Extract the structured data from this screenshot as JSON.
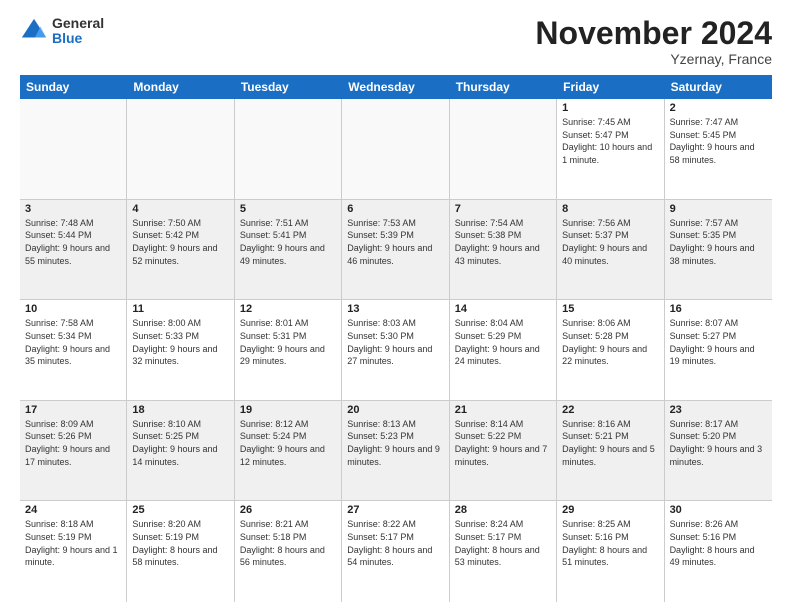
{
  "logo": {
    "general": "General",
    "blue": "Blue"
  },
  "title": "November 2024",
  "location": "Yzernay, France",
  "days": [
    "Sunday",
    "Monday",
    "Tuesday",
    "Wednesday",
    "Thursday",
    "Friday",
    "Saturday"
  ],
  "weeks": [
    [
      {
        "day": "",
        "info": ""
      },
      {
        "day": "",
        "info": ""
      },
      {
        "day": "",
        "info": ""
      },
      {
        "day": "",
        "info": ""
      },
      {
        "day": "",
        "info": ""
      },
      {
        "day": "1",
        "info": "Sunrise: 7:45 AM\nSunset: 5:47 PM\nDaylight: 10 hours and 1 minute."
      },
      {
        "day": "2",
        "info": "Sunrise: 7:47 AM\nSunset: 5:45 PM\nDaylight: 9 hours and 58 minutes."
      }
    ],
    [
      {
        "day": "3",
        "info": "Sunrise: 7:48 AM\nSunset: 5:44 PM\nDaylight: 9 hours and 55 minutes."
      },
      {
        "day": "4",
        "info": "Sunrise: 7:50 AM\nSunset: 5:42 PM\nDaylight: 9 hours and 52 minutes."
      },
      {
        "day": "5",
        "info": "Sunrise: 7:51 AM\nSunset: 5:41 PM\nDaylight: 9 hours and 49 minutes."
      },
      {
        "day": "6",
        "info": "Sunrise: 7:53 AM\nSunset: 5:39 PM\nDaylight: 9 hours and 46 minutes."
      },
      {
        "day": "7",
        "info": "Sunrise: 7:54 AM\nSunset: 5:38 PM\nDaylight: 9 hours and 43 minutes."
      },
      {
        "day": "8",
        "info": "Sunrise: 7:56 AM\nSunset: 5:37 PM\nDaylight: 9 hours and 40 minutes."
      },
      {
        "day": "9",
        "info": "Sunrise: 7:57 AM\nSunset: 5:35 PM\nDaylight: 9 hours and 38 minutes."
      }
    ],
    [
      {
        "day": "10",
        "info": "Sunrise: 7:58 AM\nSunset: 5:34 PM\nDaylight: 9 hours and 35 minutes."
      },
      {
        "day": "11",
        "info": "Sunrise: 8:00 AM\nSunset: 5:33 PM\nDaylight: 9 hours and 32 minutes."
      },
      {
        "day": "12",
        "info": "Sunrise: 8:01 AM\nSunset: 5:31 PM\nDaylight: 9 hours and 29 minutes."
      },
      {
        "day": "13",
        "info": "Sunrise: 8:03 AM\nSunset: 5:30 PM\nDaylight: 9 hours and 27 minutes."
      },
      {
        "day": "14",
        "info": "Sunrise: 8:04 AM\nSunset: 5:29 PM\nDaylight: 9 hours and 24 minutes."
      },
      {
        "day": "15",
        "info": "Sunrise: 8:06 AM\nSunset: 5:28 PM\nDaylight: 9 hours and 22 minutes."
      },
      {
        "day": "16",
        "info": "Sunrise: 8:07 AM\nSunset: 5:27 PM\nDaylight: 9 hours and 19 minutes."
      }
    ],
    [
      {
        "day": "17",
        "info": "Sunrise: 8:09 AM\nSunset: 5:26 PM\nDaylight: 9 hours and 17 minutes."
      },
      {
        "day": "18",
        "info": "Sunrise: 8:10 AM\nSunset: 5:25 PM\nDaylight: 9 hours and 14 minutes."
      },
      {
        "day": "19",
        "info": "Sunrise: 8:12 AM\nSunset: 5:24 PM\nDaylight: 9 hours and 12 minutes."
      },
      {
        "day": "20",
        "info": "Sunrise: 8:13 AM\nSunset: 5:23 PM\nDaylight: 9 hours and 9 minutes."
      },
      {
        "day": "21",
        "info": "Sunrise: 8:14 AM\nSunset: 5:22 PM\nDaylight: 9 hours and 7 minutes."
      },
      {
        "day": "22",
        "info": "Sunrise: 8:16 AM\nSunset: 5:21 PM\nDaylight: 9 hours and 5 minutes."
      },
      {
        "day": "23",
        "info": "Sunrise: 8:17 AM\nSunset: 5:20 PM\nDaylight: 9 hours and 3 minutes."
      }
    ],
    [
      {
        "day": "24",
        "info": "Sunrise: 8:18 AM\nSunset: 5:19 PM\nDaylight: 9 hours and 1 minute."
      },
      {
        "day": "25",
        "info": "Sunrise: 8:20 AM\nSunset: 5:19 PM\nDaylight: 8 hours and 58 minutes."
      },
      {
        "day": "26",
        "info": "Sunrise: 8:21 AM\nSunset: 5:18 PM\nDaylight: 8 hours and 56 minutes."
      },
      {
        "day": "27",
        "info": "Sunrise: 8:22 AM\nSunset: 5:17 PM\nDaylight: 8 hours and 54 minutes."
      },
      {
        "day": "28",
        "info": "Sunrise: 8:24 AM\nSunset: 5:17 PM\nDaylight: 8 hours and 53 minutes."
      },
      {
        "day": "29",
        "info": "Sunrise: 8:25 AM\nSunset: 5:16 PM\nDaylight: 8 hours and 51 minutes."
      },
      {
        "day": "30",
        "info": "Sunrise: 8:26 AM\nSunset: 5:16 PM\nDaylight: 8 hours and 49 minutes."
      }
    ]
  ]
}
